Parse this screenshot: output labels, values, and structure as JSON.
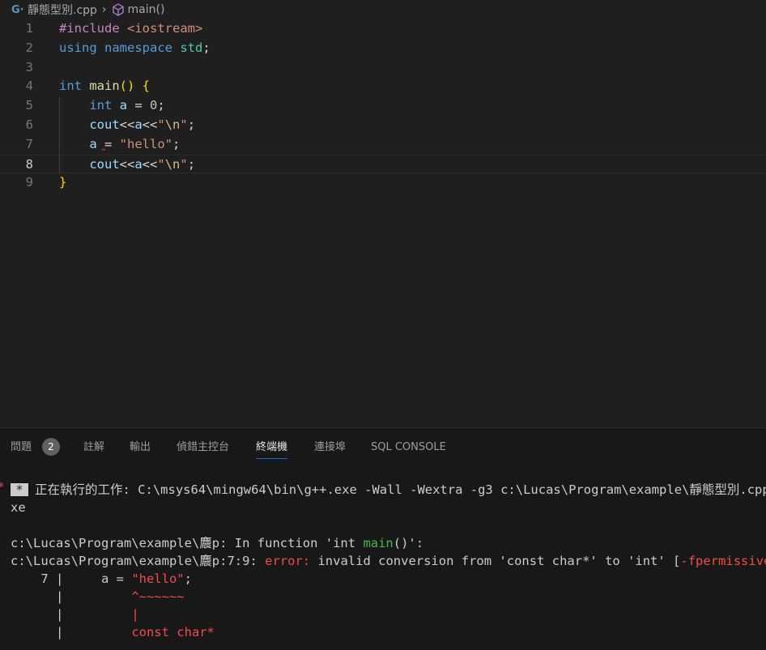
{
  "breadcrumb": {
    "file": "靜態型別.cpp",
    "symbol": "main()"
  },
  "editor": {
    "line_numbers": [
      "1",
      "2",
      "3",
      "4",
      "5",
      "6",
      "7",
      "8",
      "9"
    ],
    "lines": [
      [
        {
          "t": "#include ",
          "c": "c-dir"
        },
        {
          "t": "<iostream>",
          "c": "c-str"
        }
      ],
      [
        {
          "t": "using ",
          "c": "c-kw"
        },
        {
          "t": "namespace ",
          "c": "c-kw"
        },
        {
          "t": "std",
          "c": "c-type"
        },
        {
          "t": ";",
          "c": "c-def"
        }
      ],
      [],
      [
        {
          "t": "int ",
          "c": "c-kw"
        },
        {
          "t": "main",
          "c": "c-fn"
        },
        {
          "t": "() ",
          "c": "c-br"
        },
        {
          "t": "{",
          "c": "c-br"
        }
      ],
      [
        {
          "t": "    ",
          "c": "c-def"
        },
        {
          "t": "int ",
          "c": "c-kw"
        },
        {
          "t": "a",
          "c": "c-var"
        },
        {
          "t": " = ",
          "c": "c-def"
        },
        {
          "t": "0",
          "c": "c-num"
        },
        {
          "t": ";",
          "c": "c-def"
        }
      ],
      [
        {
          "t": "    ",
          "c": "c-def"
        },
        {
          "t": "cout",
          "c": "c-var"
        },
        {
          "t": "<<",
          "c": "c-def"
        },
        {
          "t": "a",
          "c": "c-var"
        },
        {
          "t": "<<",
          "c": "c-def"
        },
        {
          "t": "\"",
          "c": "c-str"
        },
        {
          "t": "\\n",
          "c": "c-esc"
        },
        {
          "t": "\"",
          "c": "c-str"
        },
        {
          "t": ";",
          "c": "c-def"
        }
      ],
      [
        {
          "t": "    ",
          "c": "c-def"
        },
        {
          "t": "a",
          "c": "c-var"
        },
        {
          "t": " = ",
          "c": "c-def"
        },
        {
          "t": "\"hello\"",
          "c": "c-str"
        },
        {
          "t": ";",
          "c": "c-def"
        }
      ],
      [
        {
          "t": "    ",
          "c": "c-def"
        },
        {
          "t": "cout",
          "c": "c-var"
        },
        {
          "t": "<<",
          "c": "c-def"
        },
        {
          "t": "a",
          "c": "c-var"
        },
        {
          "t": "<<",
          "c": "c-def"
        },
        {
          "t": "\"",
          "c": "c-str"
        },
        {
          "t": "\\n",
          "c": "c-esc"
        },
        {
          "t": "\"",
          "c": "c-str"
        },
        {
          "t": ";",
          "c": "c-def"
        }
      ],
      [
        {
          "t": "}",
          "c": "c-br"
        }
      ]
    ],
    "squiggle": "^"
  },
  "panel": {
    "tabs": [
      "問題",
      "註解",
      "輸出",
      "偵錯主控台",
      "終端機",
      "連接埠",
      "SQL CONSOLE"
    ],
    "problems_count": "2",
    "active_tab": "終端機"
  },
  "terminal": {
    "task_star": "*",
    "task_line": "正在執行的工作: C:\\msys64\\mingw64\\bin\\g++.exe -Wall -Wextra -g3 c:\\Lucas\\Program\\example\\靜態型別.cpp",
    "task_wrap": "xe",
    "fn_line_prefix": "c:\\Lucas\\Program\\example\\麎p: In function 'int ",
    "fn_name": "main",
    "fn_line_suffix": "()':",
    "err_prefix": "c:\\Lucas\\Program\\example\\麎p:7:9: ",
    "err_word": "error:",
    "err_msg": " invalid conversion from 'const char*' to 'int' [",
    "err_flag": "-fpermissive",
    "err_close": "]",
    "src_lineno": "    7 |     a = ",
    "src_str": "\"hello\"",
    "src_end": ";",
    "caret_pipe": "      |         ",
    "caret": "^~~~~~~",
    "bar_pipe": "      |         ",
    "bar": "|",
    "type_pipe": "      |         ",
    "type_text": "const char*"
  }
}
